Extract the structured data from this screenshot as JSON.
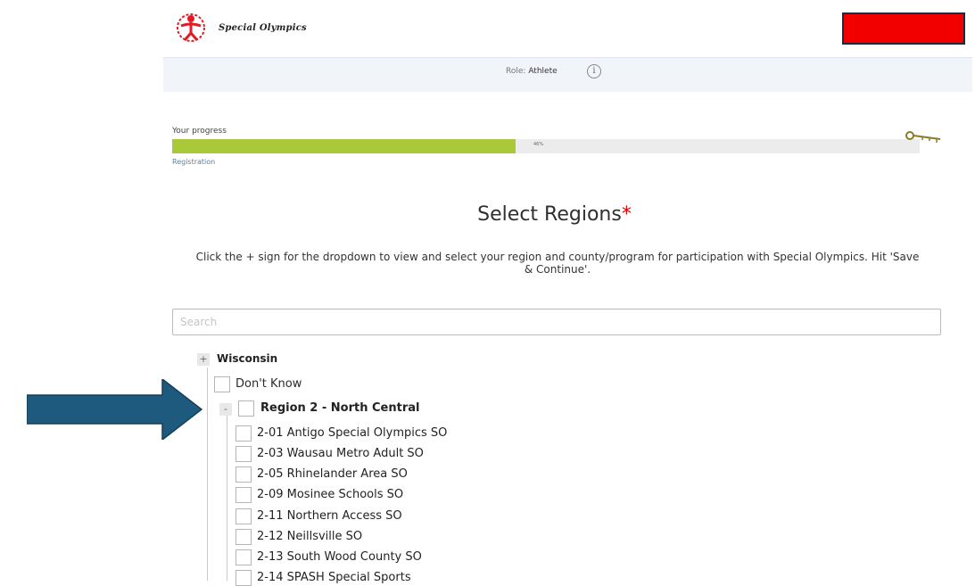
{
  "header": {
    "logo_text": "Special Olympics",
    "role_label": "Role:",
    "role_value": "Athlete",
    "info_icon": "info-icon"
  },
  "progress": {
    "label": "Your progress",
    "percent": 46,
    "percent_text": "46%",
    "step": "Registration"
  },
  "page": {
    "title": "Select Regions",
    "required_mark": "*",
    "instructions": "Click the + sign for the dropdown to view and select your region and county/program for participation with Special Olympics. Hit 'Save & Continue'."
  },
  "search": {
    "placeholder": "Search",
    "value": ""
  },
  "tree": {
    "root": {
      "expander": "+",
      "label": "Wisconsin"
    },
    "dont_know": {
      "label": "Don't Know",
      "checked": false
    },
    "region": {
      "expander": "-",
      "label": "Region 2 - North Central",
      "checked": false
    },
    "programs": [
      {
        "label": "2-01 Antigo Special Olympics SO",
        "checked": false
      },
      {
        "label": "2-03 Wausau Metro Adult SO",
        "checked": false
      },
      {
        "label": "2-05 Rhinelander Area SO",
        "checked": false
      },
      {
        "label": "2-09 Mosinee Schools SO",
        "checked": false
      },
      {
        "label": "2-11 Northern Access SO",
        "checked": false
      },
      {
        "label": "2-12 Neillsville SO",
        "checked": false
      },
      {
        "label": "2-13 South Wood County SO",
        "checked": false
      },
      {
        "label": "2-14 SPASH Special Sports",
        "checked": false
      }
    ]
  },
  "colors": {
    "progress_fill": "#a9c93b",
    "redaction": "#f20000",
    "arrow": "#1e5a7e",
    "required": "#e00000"
  }
}
